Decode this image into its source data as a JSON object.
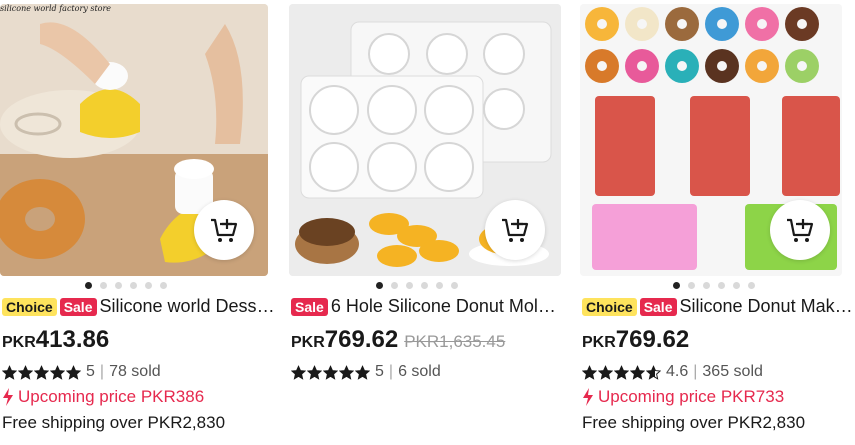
{
  "colors": {
    "sale_red": "#e6294e",
    "choice_yellow": "#fee35d",
    "text": "#191919",
    "muted": "#999999"
  },
  "products": [
    {
      "watermark": "silicone world factory store",
      "badges": {
        "choice": "Choice",
        "sale": "Sale"
      },
      "title": "Silicone world Desse…",
      "currency": "PKR",
      "price": "413.86",
      "rating": "5",
      "rating_stars": 5,
      "sold": "78 sold",
      "upcoming": "Upcoming price PKR386",
      "shipping": "Free shipping over PKR2,830",
      "carousel_index": 0,
      "carousel_count": 6
    },
    {
      "badges": {
        "sale": "Sale"
      },
      "title": "6 Hole Silicone Donut Mol…",
      "currency": "PKR",
      "price": "769.62",
      "original_price": "PKR1,635.45",
      "rating": "5",
      "rating_stars": 5,
      "sold": "6 sold",
      "carousel_index": 0,
      "carousel_count": 6
    },
    {
      "badges": {
        "choice": "Choice",
        "sale": "Sale"
      },
      "title": "Silicone Donut Mak…",
      "currency": "PKR",
      "price": "769.62",
      "rating": "4.6",
      "rating_stars": 4.6,
      "sold": "365 sold",
      "upcoming": "Upcoming price PKR733",
      "shipping": "Free shipping over PKR2,830",
      "carousel_index": 0,
      "carousel_count": 6
    }
  ],
  "icons": {
    "cart": "add-to-cart-icon",
    "star": "star-icon",
    "lightning": "lightning-icon"
  }
}
